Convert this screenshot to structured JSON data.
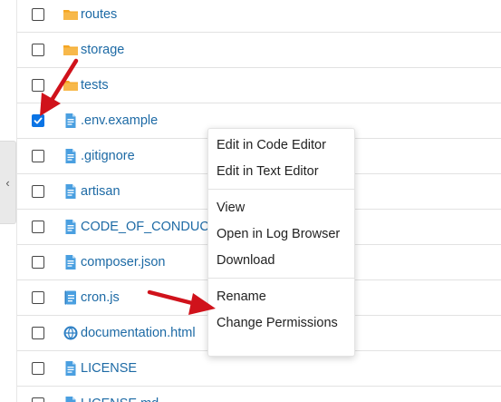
{
  "sidebar": {
    "collapse_glyph": "‹",
    "collapse_icon": "chevron-left-icon"
  },
  "files": [
    {
      "name": "routes",
      "type": "folder",
      "checked": false,
      "icon": "folder-icon"
    },
    {
      "name": "storage",
      "type": "folder",
      "checked": false,
      "icon": "folder-icon"
    },
    {
      "name": "tests",
      "type": "folder",
      "checked": false,
      "icon": "folder-icon"
    },
    {
      "name": ".env.example",
      "type": "file",
      "checked": true,
      "icon": "text-file-icon"
    },
    {
      "name": ".gitignore",
      "type": "file",
      "checked": false,
      "icon": "text-file-icon"
    },
    {
      "name": "artisan",
      "type": "file",
      "checked": false,
      "icon": "text-file-icon"
    },
    {
      "name": "CODE_OF_CONDUCT.md",
      "type": "file",
      "checked": false,
      "icon": "text-file-icon"
    },
    {
      "name": "composer.json",
      "type": "file",
      "checked": false,
      "icon": "text-file-icon"
    },
    {
      "name": "cron.js",
      "type": "script",
      "checked": false,
      "icon": "script-file-icon"
    },
    {
      "name": "documentation.html",
      "type": "html",
      "checked": false,
      "icon": "web-file-icon"
    },
    {
      "name": "LICENSE",
      "type": "file",
      "checked": false,
      "icon": "text-file-icon"
    },
    {
      "name": "LICENSE.md",
      "type": "file",
      "checked": false,
      "icon": "text-file-icon"
    }
  ],
  "context_menu": {
    "group1": [
      "Edit in Code Editor",
      "Edit in Text Editor"
    ],
    "group2": [
      "View",
      "Open in Log Browser",
      "Download"
    ],
    "group3": [
      "Rename",
      "Change Permissions"
    ]
  },
  "colors": {
    "accent": "#0b74e5",
    "link": "#1d6aa5",
    "folder": "#f5a623",
    "file_icon": "#4a9fe0",
    "annotation_arrow": "#d0121b"
  }
}
